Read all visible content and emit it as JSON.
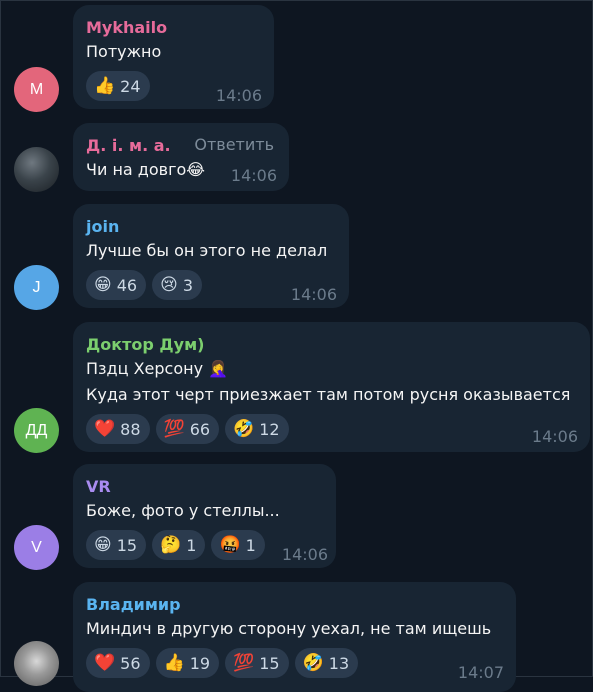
{
  "messages": [
    {
      "author": "Mykhailo",
      "author_color": "#e66b9a",
      "avatar_letter": "M",
      "avatar_color": "#e3667b",
      "text": "Потужно",
      "reactions": [
        {
          "emoji": "👍",
          "count": "24"
        }
      ],
      "time": "14:06"
    },
    {
      "author": "Д. і. м. а.",
      "author_color": "#e66b9a",
      "reply_label": "Ответить",
      "text": "Чи на довго😂",
      "time": "14:06"
    },
    {
      "author": "join",
      "author_color": "#5ab4f0",
      "avatar_letter": "J",
      "avatar_color": "#56a6e6",
      "text": "Лучше бы он этого не делал",
      "reactions": [
        {
          "emoji": "😁",
          "count": "46"
        },
        {
          "emoji": "😢",
          "count": "3"
        }
      ],
      "time": "14:06"
    },
    {
      "author": "Доктор Дум)",
      "author_color": "#7ccf6e",
      "avatar_letter": "ДД",
      "avatar_color": "#5fb352",
      "text_line1": "Пздц Херсону 🤦‍♀️",
      "text_line2": "Куда этот черт приезжает там потом русня оказывается",
      "reactions": [
        {
          "emoji": "❤️",
          "count": "88"
        },
        {
          "emoji": "💯",
          "count": "66"
        },
        {
          "emoji": "🤣",
          "count": "12"
        }
      ],
      "time": "14:06"
    },
    {
      "author": "VR",
      "author_color": "#a98cf0",
      "avatar_letter": "V",
      "avatar_color": "#9b7ee6",
      "text": "Боже, фото у стеллы...",
      "reactions": [
        {
          "emoji": "😁",
          "count": "15"
        },
        {
          "emoji": "🤔",
          "count": "1"
        },
        {
          "emoji": "🤬",
          "count": "1"
        }
      ],
      "time": "14:06"
    },
    {
      "author": "Владимир",
      "author_color": "#5ab4f0",
      "text": "Миндич в другую сторону уехал, не там ищешь",
      "reactions": [
        {
          "emoji": "❤️",
          "count": "56"
        },
        {
          "emoji": "👍",
          "count": "19"
        },
        {
          "emoji": "💯",
          "count": "15"
        },
        {
          "emoji": "🤣",
          "count": "13"
        }
      ],
      "time": "14:07"
    }
  ]
}
